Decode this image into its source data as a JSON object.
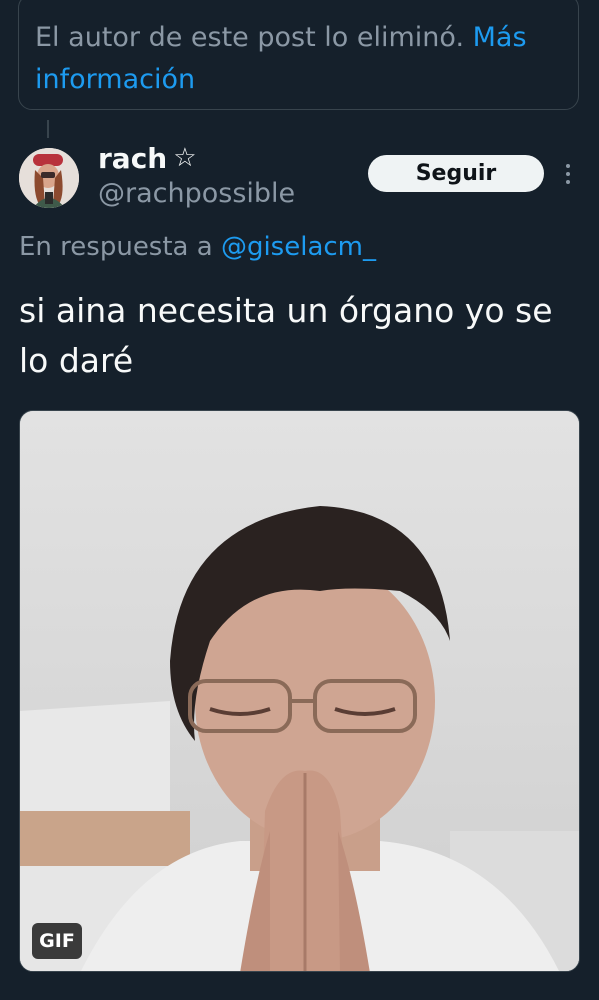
{
  "deleted_notice": {
    "text": "El autor de este post lo eliminó.",
    "link": "Más información"
  },
  "author": {
    "name": "rach",
    "name_badge": "☆",
    "handle": "@rachpossible",
    "avatar_icon": "avatar"
  },
  "follow_button": {
    "label": "Seguir"
  },
  "more_icon": "more-vertical-icon",
  "reply": {
    "prefix": "En respuesta a",
    "mention": "@giselacm_"
  },
  "post": {
    "text": "si aina necesita un órgano yo se lo daré"
  },
  "media": {
    "badge": "GIF"
  },
  "colors": {
    "background": "#15202b",
    "link": "#1d9bf0",
    "secondary_text": "#8b98a5",
    "border": "#38444d"
  }
}
